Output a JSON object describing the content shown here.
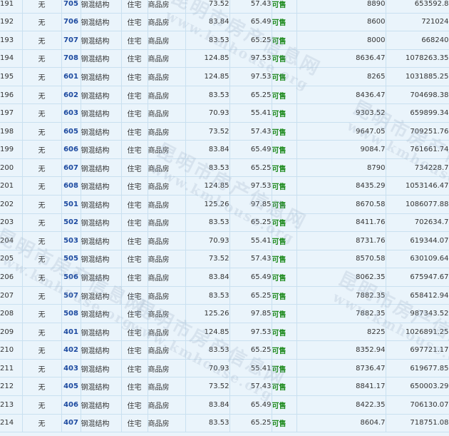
{
  "watermark": {
    "cn": "昆明市房产信息网",
    "en": "www.kmhouse.org"
  },
  "rows": [
    {
      "no": "191",
      "x": "无",
      "room": "705",
      "struct": "钢混结构",
      "use": "住宅",
      "type": "商品房",
      "area1": "73.52",
      "area2": "57.43",
      "status": "可售",
      "price": "8890",
      "total": "653592.8"
    },
    {
      "no": "192",
      "x": "无",
      "room": "706",
      "struct": "钢混结构",
      "use": "住宅",
      "type": "商品房",
      "area1": "83.84",
      "area2": "65.49",
      "status": "可售",
      "price": "8600",
      "total": "721024"
    },
    {
      "no": "193",
      "x": "无",
      "room": "707",
      "struct": "钢混结构",
      "use": "住宅",
      "type": "商品房",
      "area1": "83.53",
      "area2": "65.25",
      "status": "可售",
      "price": "8000",
      "total": "668240"
    },
    {
      "no": "194",
      "x": "无",
      "room": "708",
      "struct": "钢混结构",
      "use": "住宅",
      "type": "商品房",
      "area1": "124.85",
      "area2": "97.53",
      "status": "可售",
      "price": "8636.47",
      "total": "1078263.35"
    },
    {
      "no": "195",
      "x": "无",
      "room": "601",
      "struct": "钢混结构",
      "use": "住宅",
      "type": "商品房",
      "area1": "124.85",
      "area2": "97.53",
      "status": "可售",
      "price": "8265",
      "total": "1031885.25"
    },
    {
      "no": "196",
      "x": "无",
      "room": "602",
      "struct": "钢混结构",
      "use": "住宅",
      "type": "商品房",
      "area1": "83.53",
      "area2": "65.25",
      "status": "可售",
      "price": "8436.47",
      "total": "704698.38"
    },
    {
      "no": "197",
      "x": "无",
      "room": "603",
      "struct": "钢混结构",
      "use": "住宅",
      "type": "商品房",
      "area1": "70.93",
      "area2": "55.41",
      "status": "可售",
      "price": "9303.52",
      "total": "659899.34"
    },
    {
      "no": "198",
      "x": "无",
      "room": "605",
      "struct": "钢混结构",
      "use": "住宅",
      "type": "商品房",
      "area1": "73.52",
      "area2": "57.43",
      "status": "可售",
      "price": "9647.05",
      "total": "709251.76"
    },
    {
      "no": "199",
      "x": "无",
      "room": "606",
      "struct": "钢混结构",
      "use": "住宅",
      "type": "商品房",
      "area1": "83.84",
      "area2": "65.49",
      "status": "可售",
      "price": "9084.7",
      "total": "761661.74"
    },
    {
      "no": "200",
      "x": "无",
      "room": "607",
      "struct": "钢混结构",
      "use": "住宅",
      "type": "商品房",
      "area1": "83.53",
      "area2": "65.25",
      "status": "可售",
      "price": "8790",
      "total": "734228.7"
    },
    {
      "no": "201",
      "x": "无",
      "room": "608",
      "struct": "钢混结构",
      "use": "住宅",
      "type": "商品房",
      "area1": "124.85",
      "area2": "97.53",
      "status": "可售",
      "price": "8435.29",
      "total": "1053146.47"
    },
    {
      "no": "202",
      "x": "无",
      "room": "501",
      "struct": "钢混结构",
      "use": "住宅",
      "type": "商品房",
      "area1": "125.26",
      "area2": "97.85",
      "status": "可售",
      "price": "8670.58",
      "total": "1086077.88"
    },
    {
      "no": "203",
      "x": "无",
      "room": "502",
      "struct": "钢混结构",
      "use": "住宅",
      "type": "商品房",
      "area1": "83.53",
      "area2": "65.25",
      "status": "可售",
      "price": "8411.76",
      "total": "702634.7"
    },
    {
      "no": "204",
      "x": "无",
      "room": "503",
      "struct": "钢混结构",
      "use": "住宅",
      "type": "商品房",
      "area1": "70.93",
      "area2": "55.41",
      "status": "可售",
      "price": "8731.76",
      "total": "619344.07"
    },
    {
      "no": "205",
      "x": "无",
      "room": "505",
      "struct": "钢混结构",
      "use": "住宅",
      "type": "商品房",
      "area1": "73.52",
      "area2": "57.43",
      "status": "可售",
      "price": "8570.58",
      "total": "630109.64"
    },
    {
      "no": "206",
      "x": "无",
      "room": "506",
      "struct": "钢混结构",
      "use": "住宅",
      "type": "商品房",
      "area1": "83.84",
      "area2": "65.49",
      "status": "可售",
      "price": "8062.35",
      "total": "675947.67"
    },
    {
      "no": "207",
      "x": "无",
      "room": "507",
      "struct": "钢混结构",
      "use": "住宅",
      "type": "商品房",
      "area1": "83.53",
      "area2": "65.25",
      "status": "可售",
      "price": "7882.35",
      "total": "658412.94"
    },
    {
      "no": "208",
      "x": "无",
      "room": "508",
      "struct": "钢混结构",
      "use": "住宅",
      "type": "商品房",
      "area1": "125.26",
      "area2": "97.85",
      "status": "可售",
      "price": "7882.35",
      "total": "987343.52"
    },
    {
      "no": "209",
      "x": "无",
      "room": "401",
      "struct": "钢混结构",
      "use": "住宅",
      "type": "商品房",
      "area1": "124.85",
      "area2": "97.53",
      "status": "可售",
      "price": "8225",
      "total": "1026891.25"
    },
    {
      "no": "210",
      "x": "无",
      "room": "402",
      "struct": "钢混结构",
      "use": "住宅",
      "type": "商品房",
      "area1": "83.53",
      "area2": "65.25",
      "status": "可售",
      "price": "8352.94",
      "total": "697721.17"
    },
    {
      "no": "211",
      "x": "无",
      "room": "403",
      "struct": "钢混结构",
      "use": "住宅",
      "type": "商品房",
      "area1": "70.93",
      "area2": "55.41",
      "status": "可售",
      "price": "8736.47",
      "total": "619677.85"
    },
    {
      "no": "212",
      "x": "无",
      "room": "405",
      "struct": "钢混结构",
      "use": "住宅",
      "type": "商品房",
      "area1": "73.52",
      "area2": "57.43",
      "status": "可售",
      "price": "8841.17",
      "total": "650003.29"
    },
    {
      "no": "213",
      "x": "无",
      "room": "406",
      "struct": "钢混结构",
      "use": "住宅",
      "type": "商品房",
      "area1": "83.84",
      "area2": "65.49",
      "status": "可售",
      "price": "8422.35",
      "total": "706130.07"
    },
    {
      "no": "214",
      "x": "无",
      "room": "407",
      "struct": "钢混结构",
      "use": "住宅",
      "type": "商品房",
      "area1": "83.53",
      "area2": "65.25",
      "status": "可售",
      "price": "8604.7",
      "total": "718751.08"
    }
  ]
}
